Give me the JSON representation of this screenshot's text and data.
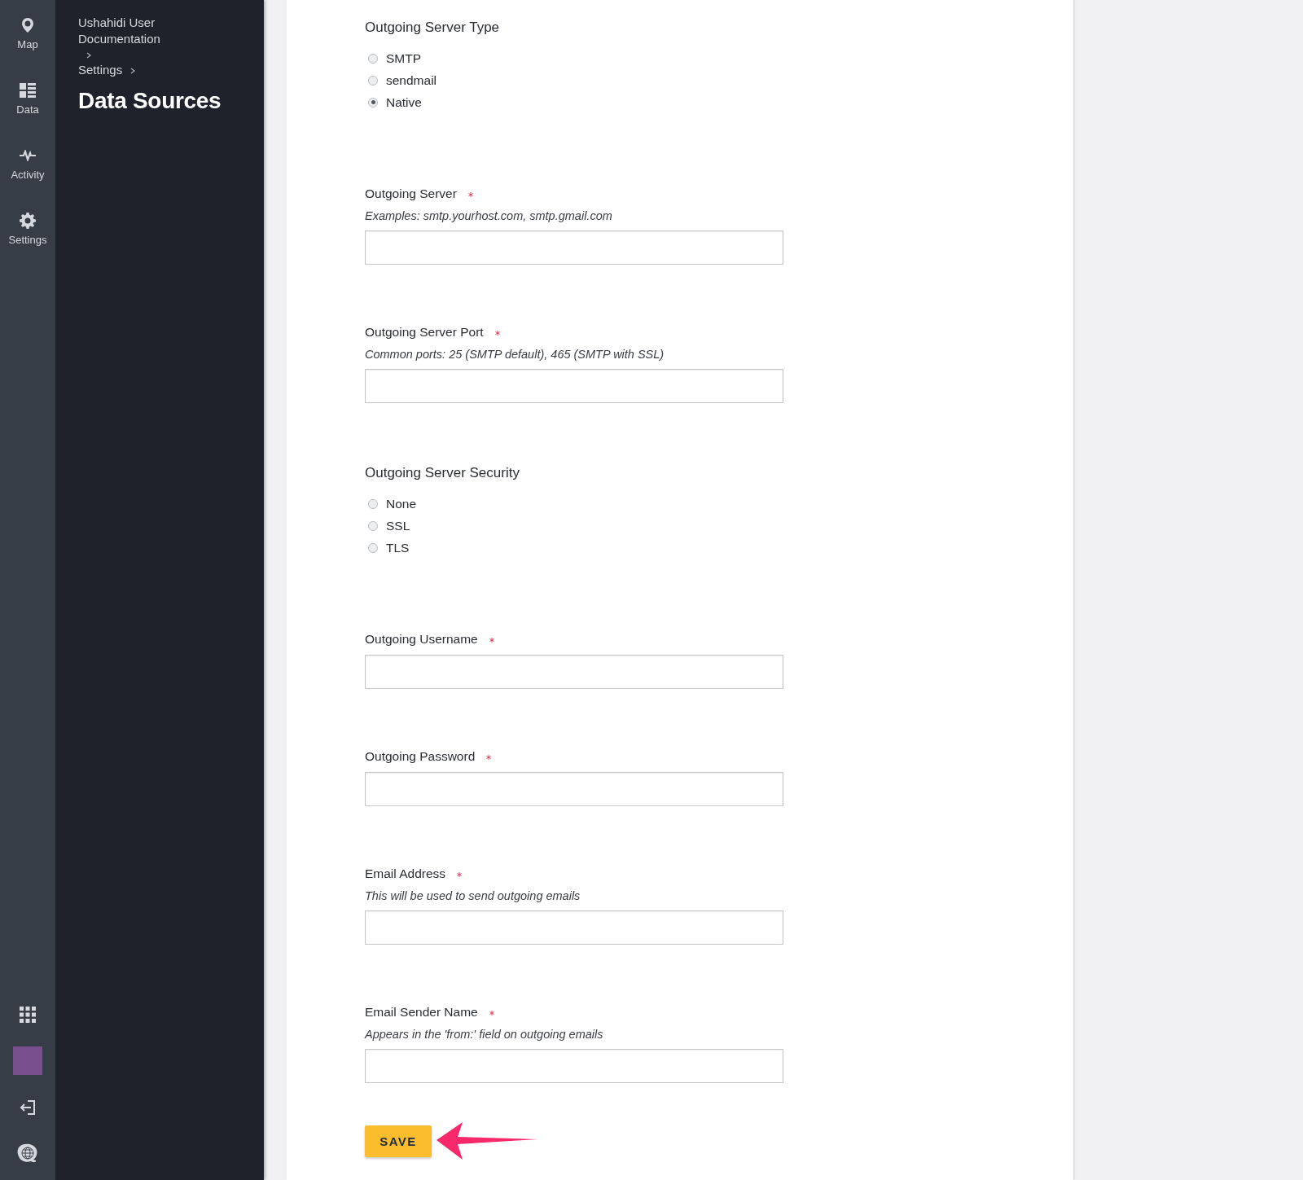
{
  "nav": {
    "items": [
      {
        "label": "Map"
      },
      {
        "label": "Data"
      },
      {
        "label": "Activity"
      },
      {
        "label": "Settings"
      }
    ],
    "bottom": [
      {
        "kind": "apps"
      },
      {
        "kind": "avatar"
      },
      {
        "kind": "logout"
      },
      {
        "kind": "logo"
      }
    ]
  },
  "breadcrumbs": [
    "Ushahidi User Documentation",
    "Settings"
  ],
  "title": "Data Sources",
  "form": {
    "sections": [
      {
        "kind": "radio_group",
        "label": "Outgoing Server Type",
        "options": [
          {
            "label": "SMTP",
            "selected": false
          },
          {
            "label": "sendmail",
            "selected": false
          },
          {
            "label": "Native",
            "selected": true
          }
        ]
      },
      {
        "kind": "field",
        "label": "Outgoing Server",
        "required": true,
        "hint": "Examples: smtp.yourhost.com, smtp.gmail.com"
      },
      {
        "kind": "field",
        "label": "Outgoing Server Port",
        "required": true,
        "hint": "Common ports: 25 (SMTP default), 465 (SMTP with SSL)"
      },
      {
        "kind": "radio_group",
        "label": "Outgoing Server Security",
        "options": [
          {
            "label": "None",
            "selected": false
          },
          {
            "label": "SSL",
            "selected": false
          },
          {
            "label": "TLS",
            "selected": false
          }
        ]
      },
      {
        "kind": "field",
        "label": "Outgoing Username",
        "required": true
      },
      {
        "kind": "field",
        "label": "Outgoing Password",
        "required": true
      },
      {
        "kind": "field",
        "label": "Email Address",
        "required": true,
        "hint": "This will be used to send outgoing emails"
      },
      {
        "kind": "field",
        "label": "Email Sender Name",
        "required": true,
        "hint": "Appears in the 'from:' field on outgoing emails"
      }
    ],
    "save": "SAVE"
  }
}
